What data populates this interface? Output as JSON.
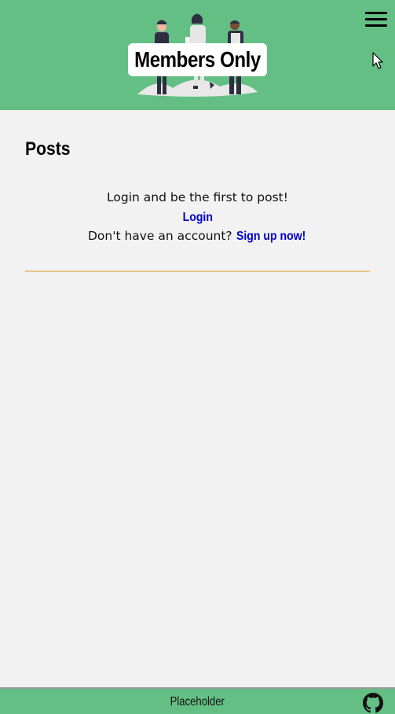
{
  "header": {
    "title": "Members Only",
    "menu_icon": "hamburger-menu-icon",
    "background_color": "#64bf85"
  },
  "main": {
    "heading": "Posts",
    "empty_message": "Login and be the first to post!",
    "login_link": "Login",
    "signup_prompt": "Don't have an account?",
    "signup_link": "Sign up now!",
    "link_color": "#0000cc",
    "divider_color": "#e6c48e"
  },
  "footer": {
    "text": "Placeholder",
    "github_icon": "github-icon"
  }
}
